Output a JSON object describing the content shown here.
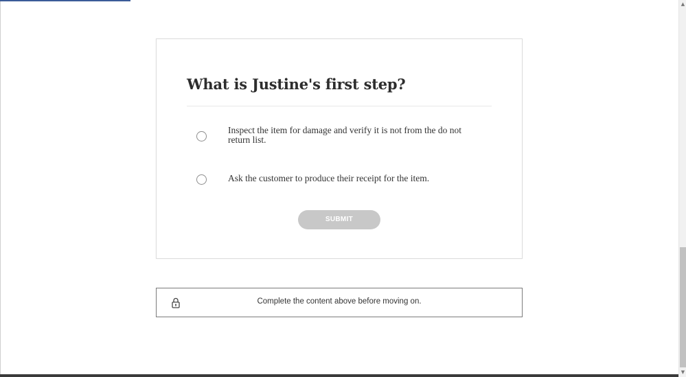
{
  "quiz": {
    "question": "What is Justine's first step?",
    "options": [
      {
        "label": "Inspect the item for damage and verify it is not from the do not return list."
      },
      {
        "label": "Ask the customer to produce their receipt for the item."
      }
    ],
    "submit_label": "SUBMIT"
  },
  "lock_notice": {
    "icon": "lock-icon",
    "text": "Complete the content above before moving on."
  },
  "colors": {
    "progress": "#3b5b98",
    "submit_disabled": "#c8c8c8"
  }
}
